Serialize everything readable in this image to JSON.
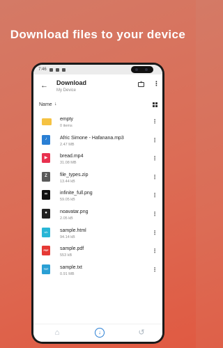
{
  "headline": "Download files to your device",
  "status": {
    "time": "7:46"
  },
  "appbar": {
    "back_glyph": "←",
    "title": "Download",
    "subtitle": "My Device",
    "more_glyph": "⋮"
  },
  "sort": {
    "label": "Name",
    "arrow": "↓"
  },
  "files": [
    {
      "name": "empty",
      "meta": "0 items",
      "icon": "folder-icon",
      "color": "#f5c242",
      "badge": ""
    },
    {
      "name": "Afric Simone - Hafanana.mp3",
      "meta": "2.47 MB",
      "icon": "music-file-icon",
      "color": "#2a7fd4",
      "badge": "♪"
    },
    {
      "name": "bread.mp4",
      "meta": "31.08 MB",
      "icon": "video-file-icon",
      "color": "#e8314f",
      "badge": "▶"
    },
    {
      "name": "file_types.zip",
      "meta": "13.44 kB",
      "icon": "zip-file-icon",
      "color": "#5a5a5a",
      "badge": "Z"
    },
    {
      "name": "infinite_full.png",
      "meta": "59.05 kB",
      "icon": "image-thumbnail-icon",
      "color": "#111111",
      "badge": "∞"
    },
    {
      "name": "noavatar.png",
      "meta": "2.05 kB",
      "icon": "avatar-thumbnail-icon",
      "color": "#222222",
      "badge": "●"
    },
    {
      "name": "sample.html",
      "meta": "94.14 kB",
      "icon": "html-file-icon",
      "color": "#29b6d6",
      "badge": "</>"
    },
    {
      "name": "sample.pdf",
      "meta": "553 kB",
      "icon": "pdf-file-icon",
      "color": "#e53935",
      "badge": "PDF"
    },
    {
      "name": "sample.txt",
      "meta": "0.91 MB",
      "icon": "text-file-icon",
      "color": "#2a9fd4",
      "badge": "TXT"
    }
  ],
  "row_more_glyph": "⋮",
  "nav": {
    "home_glyph": "⌂",
    "download_glyph": "↓",
    "history_glyph": "↺"
  },
  "colors": {
    "accent": "#2a7fd4",
    "background_top": "#d47a66",
    "background_bottom": "#e05a42"
  }
}
